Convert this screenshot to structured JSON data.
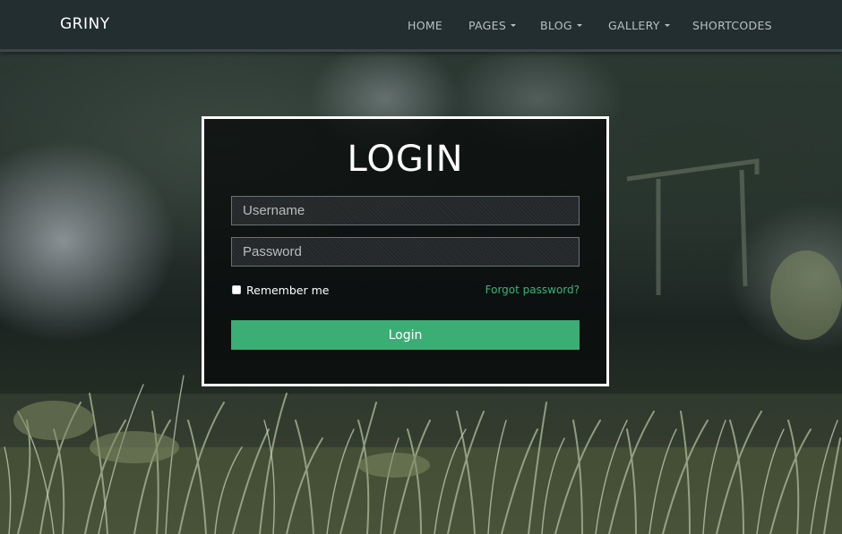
{
  "header": {
    "brand": "GRINY",
    "nav": [
      {
        "label": "HOME",
        "has_dropdown": false
      },
      {
        "label": "PAGES",
        "has_dropdown": true
      },
      {
        "label": "BLOG",
        "has_dropdown": true
      },
      {
        "label": "GALLERY",
        "has_dropdown": true
      },
      {
        "label": "SHORTCODES",
        "has_dropdown": false
      }
    ]
  },
  "login": {
    "title": "LOGIN",
    "username_placeholder": "Username",
    "password_placeholder": "Password",
    "remember_label": "Remember me",
    "remember_checked": false,
    "forgot_label": "Forgot password?",
    "submit_label": "Login"
  },
  "colors": {
    "header_bg": "#232e31",
    "accent_green": "#3bae76",
    "panel_border": "#ffffff"
  },
  "icons": [
    "chevron-down-icon",
    "checkbox-icon"
  ]
}
